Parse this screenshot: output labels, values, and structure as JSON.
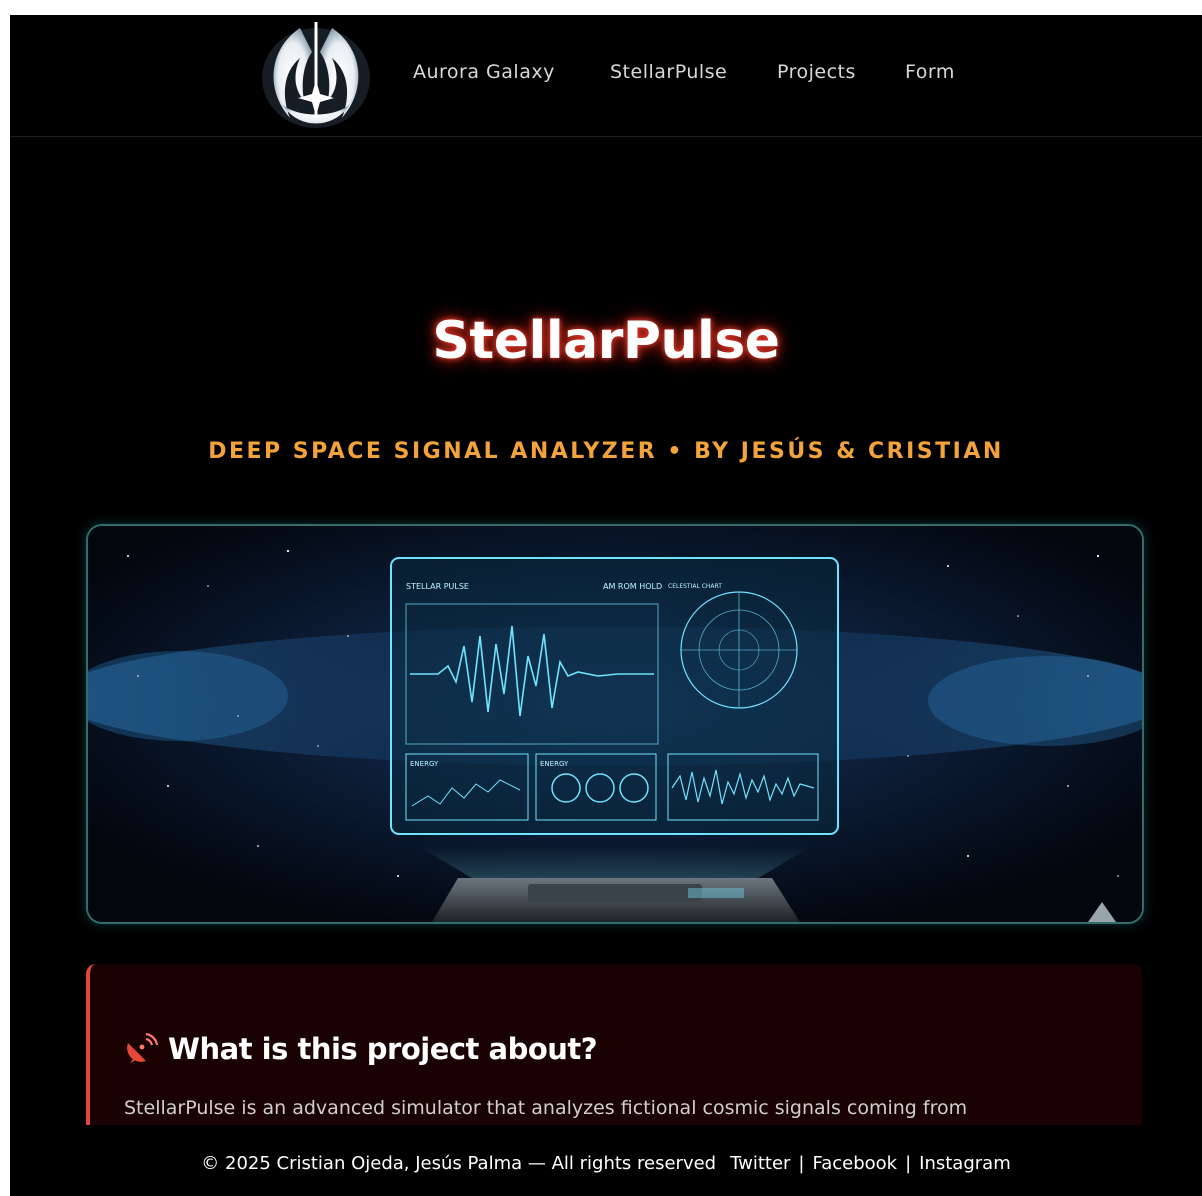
{
  "nav": {
    "items": [
      {
        "label": "Aurora Galaxy"
      },
      {
        "label": "StellarPulse"
      },
      {
        "label": "Projects"
      },
      {
        "label": "Form"
      }
    ]
  },
  "hero": {
    "title": "StellarPulse",
    "subtitle": "DEEP SPACE SIGNAL ANALYZER • BY JESÚS & CRISTIAN"
  },
  "hologram": {
    "brand": "STELLAR PULSE",
    "status": "AM ROM HOLD",
    "chart_label": "CELESTIAL CHART",
    "energy_label": "ENERGY",
    "energy_label_2": "ENERGY"
  },
  "about": {
    "heading": "What is this project about?",
    "body": "StellarPulse is an advanced simulator that analyzes fictional cosmic signals coming from"
  },
  "footer": {
    "copyright": "© 2025 Cristian Ojeda, Jesús Palma — All rights reserved",
    "links": [
      {
        "label": "Twitter"
      },
      {
        "label": "Facebook"
      },
      {
        "label": "Instagram"
      }
    ],
    "separator": "|"
  },
  "colors": {
    "background": "#000000",
    "accent_orange": "#f2a33a",
    "accent_red": "#e5483b",
    "card_bg": "#1a0202",
    "teal_border": "#2f6e6c"
  }
}
